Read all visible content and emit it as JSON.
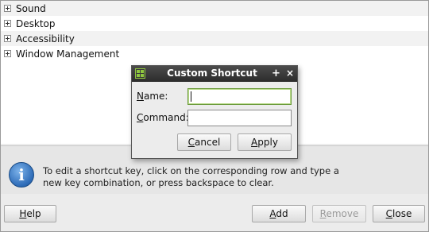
{
  "tree": {
    "items": [
      {
        "label": "Sound"
      },
      {
        "label": "Desktop"
      },
      {
        "label": "Accessibility"
      },
      {
        "label": "Window Management"
      }
    ]
  },
  "info": {
    "icon": "info-icon",
    "text": "To edit a shortcut key, click on the corresponding row and type a new key combination, or press backspace to clear."
  },
  "buttons": {
    "help": {
      "u": "H",
      "rest": "elp"
    },
    "add": {
      "u": "A",
      "rest": "dd"
    },
    "remove": {
      "u": "R",
      "rest": "emove"
    },
    "close": {
      "u": "C",
      "rest": "lose"
    }
  },
  "dialog": {
    "title": "Custom Shortcut",
    "plus": "+",
    "close": "×",
    "name_label": {
      "u": "N",
      "rest": "ame:"
    },
    "name_value": "",
    "command_label": {
      "u": "C",
      "rest": "ommand:"
    },
    "command_value": "",
    "cancel": {
      "u": "C",
      "rest": "ancel"
    },
    "apply": {
      "u": "A",
      "rest": "pply"
    }
  },
  "colors": {
    "titlebar": "#2c2c2c",
    "focus_border": "#6a9a3a",
    "info_blue": "#2d6bb7"
  }
}
